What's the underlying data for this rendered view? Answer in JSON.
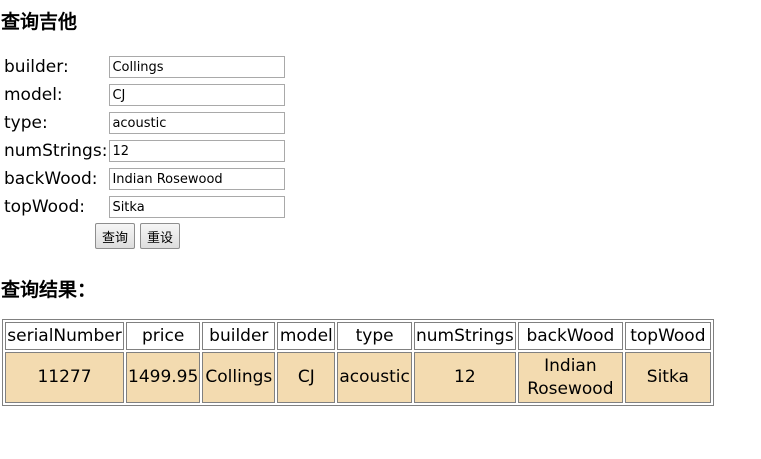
{
  "search": {
    "title": "查询吉他",
    "fields": [
      {
        "label": "builder:",
        "value": "Collings"
      },
      {
        "label": "model:",
        "value": "CJ"
      },
      {
        "label": "type:",
        "value": "acoustic"
      },
      {
        "label": "numStrings:",
        "value": "12"
      },
      {
        "label": "backWood:",
        "value": "Indian Rosewood"
      },
      {
        "label": "topWood:",
        "value": "Sitka"
      }
    ],
    "query_button": "查询",
    "reset_button": "重设"
  },
  "result": {
    "title": "查询结果：",
    "columns": [
      "serialNumber",
      "price",
      "builder",
      "model",
      "type",
      "numStrings",
      "backWood",
      "topWood"
    ],
    "rows": [
      [
        "11277",
        "1499.95",
        "Collings",
        "CJ",
        "acoustic",
        "12",
        "Indian Rosewood",
        "Sitka"
      ]
    ]
  },
  "colors": {
    "row_background": "#f3dbb0"
  }
}
